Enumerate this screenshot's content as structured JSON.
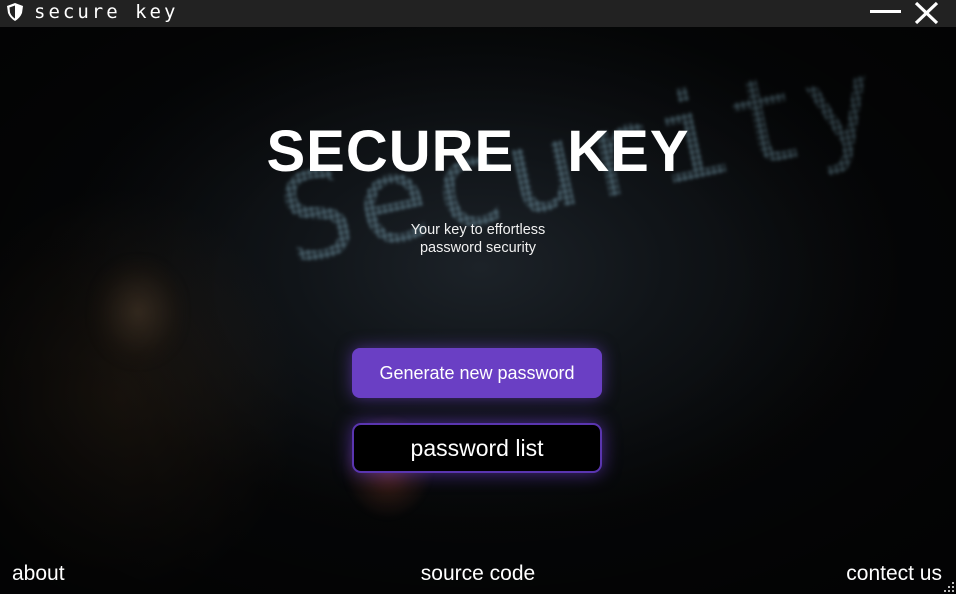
{
  "window": {
    "title": "secure key",
    "icon": "shield-icon",
    "controls": {
      "minimize_icon": "minimize-icon",
      "close_icon": "close-icon"
    }
  },
  "main": {
    "heading": "SECURE KEY",
    "tagline_line1": "Your key to effortless",
    "tagline_line2": "password security",
    "generate_button_label": "Generate new password",
    "list_button_label": "password list"
  },
  "footer": {
    "about": "about",
    "source_code": "source code",
    "contact": "contect us"
  },
  "colors": {
    "titlebar": "#222222",
    "accent": "#6a3fc4",
    "accent_border": "#5a35b0",
    "text": "#ffffff"
  }
}
